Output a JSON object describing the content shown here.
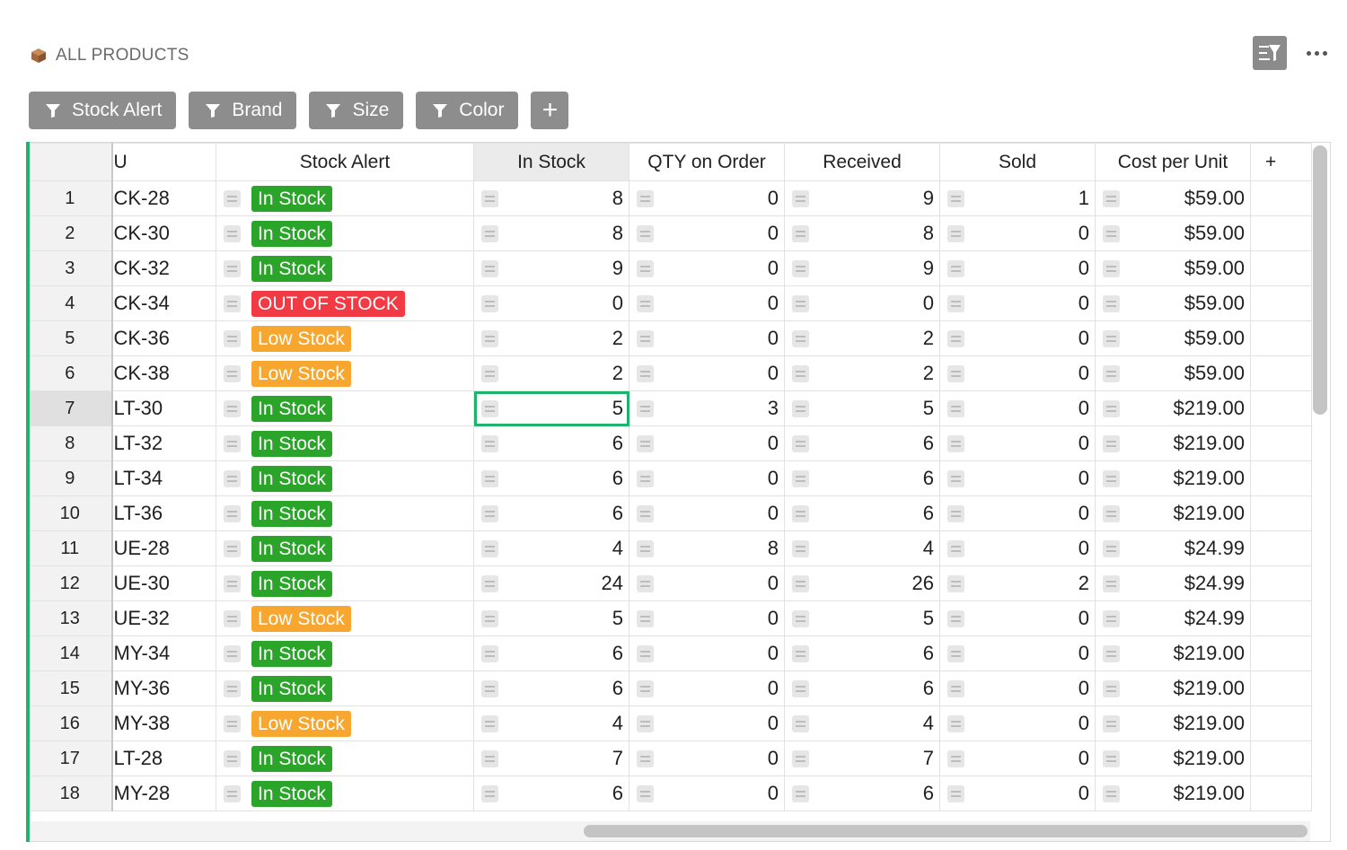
{
  "header": {
    "title": "ALL PRODUCTS",
    "icon": "package-icon"
  },
  "toolbar": {
    "filter_toggle_icon": "filter-list-icon",
    "more_icon": "more-horizontal-icon"
  },
  "filters": [
    {
      "label": "Stock Alert"
    },
    {
      "label": "Brand"
    },
    {
      "label": "Size"
    },
    {
      "label": "Color"
    }
  ],
  "add_filter_label": "+",
  "columns": {
    "sku": "U",
    "stock_alert": "Stock Alert",
    "in_stock": "In Stock",
    "qty_on_order": "QTY on Order",
    "received": "Received",
    "sold": "Sold",
    "cost_per_unit": "Cost per Unit",
    "add": "+"
  },
  "colors": {
    "in_stock": "#2aa52a",
    "out_of_stock": "#f23a44",
    "low_stock": "#f7a630",
    "accent": "#1fb36b"
  },
  "rows": [
    {
      "n": "1",
      "sku": "CK-28",
      "alert": "In Stock",
      "in_stock": "8",
      "qty": "0",
      "received": "9",
      "sold": "1",
      "cost": "$59.00"
    },
    {
      "n": "2",
      "sku": "CK-30",
      "alert": "In Stock",
      "in_stock": "8",
      "qty": "0",
      "received": "8",
      "sold": "0",
      "cost": "$59.00"
    },
    {
      "n": "3",
      "sku": "CK-32",
      "alert": "In Stock",
      "in_stock": "9",
      "qty": "0",
      "received": "9",
      "sold": "0",
      "cost": "$59.00"
    },
    {
      "n": "4",
      "sku": "CK-34",
      "alert": "OUT OF STOCK",
      "in_stock": "0",
      "qty": "0",
      "received": "0",
      "sold": "0",
      "cost": "$59.00"
    },
    {
      "n": "5",
      "sku": "CK-36",
      "alert": "Low Stock",
      "in_stock": "2",
      "qty": "0",
      "received": "2",
      "sold": "0",
      "cost": "$59.00"
    },
    {
      "n": "6",
      "sku": "CK-38",
      "alert": "Low Stock",
      "in_stock": "2",
      "qty": "0",
      "received": "2",
      "sold": "0",
      "cost": "$59.00"
    },
    {
      "n": "7",
      "sku": "LT-30",
      "alert": "In Stock",
      "in_stock": "5",
      "qty": "3",
      "received": "5",
      "sold": "0",
      "cost": "$219.00"
    },
    {
      "n": "8",
      "sku": "LT-32",
      "alert": "In Stock",
      "in_stock": "6",
      "qty": "0",
      "received": "6",
      "sold": "0",
      "cost": "$219.00"
    },
    {
      "n": "9",
      "sku": "LT-34",
      "alert": "In Stock",
      "in_stock": "6",
      "qty": "0",
      "received": "6",
      "sold": "0",
      "cost": "$219.00"
    },
    {
      "n": "10",
      "sku": "LT-36",
      "alert": "In Stock",
      "in_stock": "6",
      "qty": "0",
      "received": "6",
      "sold": "0",
      "cost": "$219.00"
    },
    {
      "n": "11",
      "sku": "UE-28",
      "alert": "In Stock",
      "in_stock": "4",
      "qty": "8",
      "received": "4",
      "sold": "0",
      "cost": "$24.99"
    },
    {
      "n": "12",
      "sku": "UE-30",
      "alert": "In Stock",
      "in_stock": "24",
      "qty": "0",
      "received": "26",
      "sold": "2",
      "cost": "$24.99"
    },
    {
      "n": "13",
      "sku": "UE-32",
      "alert": "Low Stock",
      "in_stock": "5",
      "qty": "0",
      "received": "5",
      "sold": "0",
      "cost": "$24.99"
    },
    {
      "n": "14",
      "sku": "MY-34",
      "alert": "In Stock",
      "in_stock": "6",
      "qty": "0",
      "received": "6",
      "sold": "0",
      "cost": "$219.00"
    },
    {
      "n": "15",
      "sku": "MY-36",
      "alert": "In Stock",
      "in_stock": "6",
      "qty": "0",
      "received": "6",
      "sold": "0",
      "cost": "$219.00"
    },
    {
      "n": "16",
      "sku": "MY-38",
      "alert": "Low Stock",
      "in_stock": "4",
      "qty": "0",
      "received": "4",
      "sold": "0",
      "cost": "$219.00"
    },
    {
      "n": "17",
      "sku": "LT-28",
      "alert": "In Stock",
      "in_stock": "7",
      "qty": "0",
      "received": "7",
      "sold": "0",
      "cost": "$219.00"
    },
    {
      "n": "18",
      "sku": "MY-28",
      "alert": "In Stock",
      "in_stock": "6",
      "qty": "0",
      "received": "6",
      "sold": "0",
      "cost": "$219.00"
    }
  ]
}
